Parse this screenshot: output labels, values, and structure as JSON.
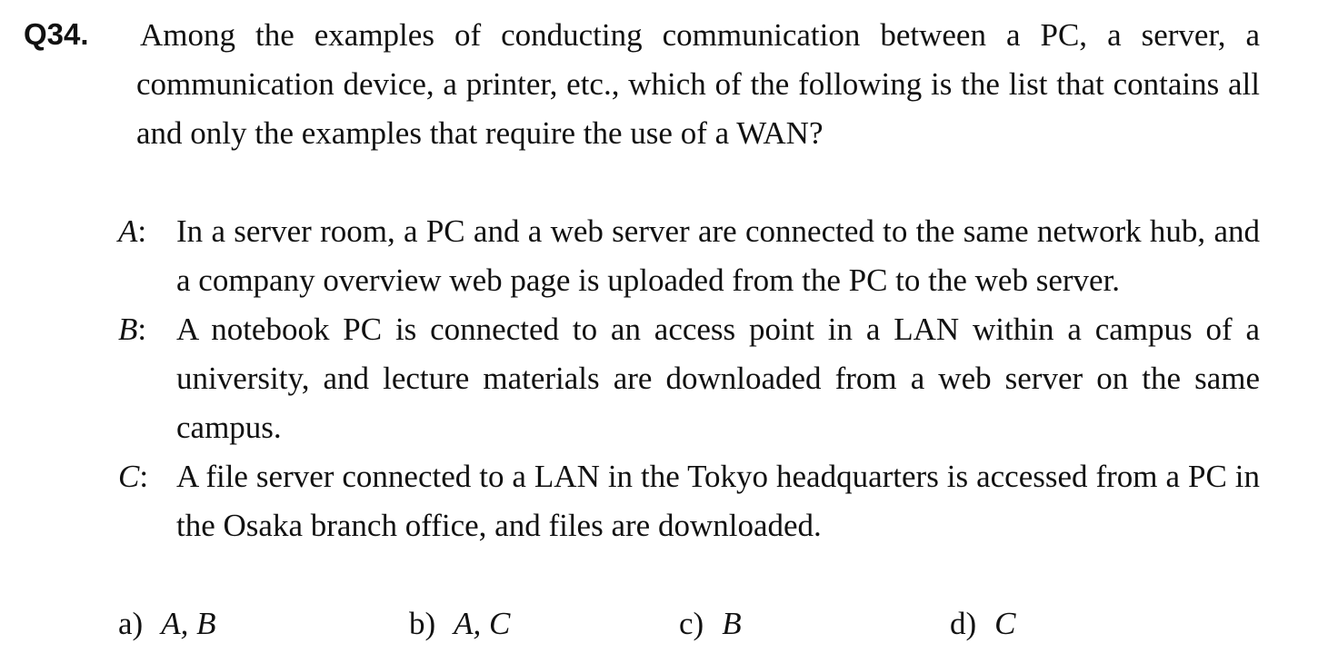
{
  "question": {
    "number": "Q34.",
    "stem": "Among the examples of conducting communication between a PC, a server, a communication device, a printer, etc., which of the following is the list that contains all and only the examples that require the use of a WAN?"
  },
  "items": [
    {
      "letter": "A",
      "separator": ":",
      "text": "In a server room, a PC and a web server are connected to the same network hub, and a company overview web page is uploaded from the PC to the web server."
    },
    {
      "letter": "B",
      "separator": ":",
      "text": "A notebook PC is connected to an access point in a LAN within a campus of a university, and lecture materials are downloaded from a web server on the same campus."
    },
    {
      "letter": "C",
      "separator": ":",
      "text": "A file server connected to a LAN in the Tokyo headquarters is accessed from a PC in the Osaka branch office, and files are downloaded."
    }
  ],
  "choices": [
    {
      "label": "a)",
      "value": "A, B"
    },
    {
      "label": "b)",
      "value": "A, C"
    },
    {
      "label": "c)",
      "value": "B"
    },
    {
      "label": "d)",
      "value": "C"
    }
  ]
}
